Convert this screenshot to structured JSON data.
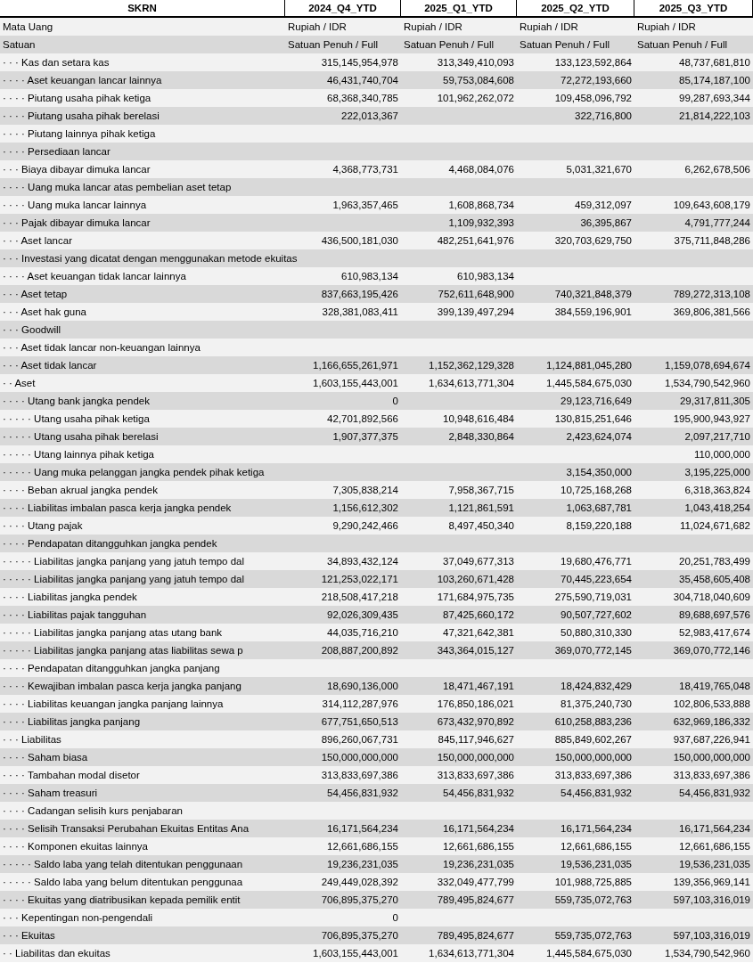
{
  "table": {
    "columns": [
      "SKRN",
      "2024_Q4_YTD",
      "2025_Q1_YTD",
      "2025_Q2_YTD",
      "2025_Q3_YTD"
    ],
    "currency_row": {
      "label": "Mata Uang",
      "column_2": "Rupiah / IDR",
      "column_3": "Rupiah / IDR",
      "column_4": "Rupiah / IDR",
      "column_5": "Rupiah / IDR"
    },
    "unit_row": {
      "label": "Satuan",
      "column_2": "Satuan Penuh / Full",
      "column_3": "Satuan Penuh / Full",
      "column_4": "Satuan Penuh / Full",
      "column_5": "Satuan Penuh / Full"
    },
    "rows": [
      {
        "label": "· · · Kas dan setara kas",
        "column_2": "315,145,954,978",
        "column_3": "313,349,410,093",
        "column_4": "133,123,592,864",
        "column_5": "48,737,681,810"
      },
      {
        "label": "· · · · Aset keuangan lancar lainnya",
        "column_2": "46,431,740,704",
        "column_3": "59,753,084,608",
        "column_4": "72,272,193,660",
        "column_5": "85,174,187,100"
      },
      {
        "label": "· · · · Piutang usaha pihak ketiga",
        "column_2": "68,368,340,785",
        "column_3": "101,962,262,072",
        "column_4": "109,458,096,792",
        "column_5": "99,287,693,344"
      },
      {
        "label": "· · · · Piutang usaha pihak berelasi",
        "column_2": "222,013,367",
        "column_4": "322,716,800",
        "column_5": "21,814,222,103"
      },
      {
        "label": "· · · · Piutang lainnya pihak ketiga"
      },
      {
        "label": "· · · · Persediaan lancar"
      },
      {
        "label": "· · · Biaya dibayar dimuka lancar",
        "column_2": "4,368,773,731",
        "column_3": "4,468,084,076",
        "column_4": "5,031,321,670",
        "column_5": "6,262,678,506"
      },
      {
        "label": "· · · · Uang muka lancar atas pembelian aset tetap"
      },
      {
        "label": "· · · · Uang muka lancar lainnya",
        "column_2": "1,963,357,465",
        "column_3": "1,608,868,734",
        "column_4": "459,312,097",
        "column_5": "109,643,608,179"
      },
      {
        "label": "· · · Pajak dibayar dimuka lancar",
        "column_3": "1,109,932,393",
        "column_4": "36,395,867",
        "column_5": "4,791,777,244"
      },
      {
        "label": "· · · Aset lancar",
        "column_2": "436,500,181,030",
        "column_3": "482,251,641,976",
        "column_4": "320,703,629,750",
        "column_5": "375,711,848,286"
      },
      {
        "label": "· · · Investasi yang dicatat dengan menggunakan metode ekuitas"
      },
      {
        "label": "· · · · Aset keuangan tidak lancar lainnya",
        "column_2": "610,983,134",
        "column_3": "610,983,134"
      },
      {
        "label": "· · · Aset tetap",
        "column_2": "837,663,195,426",
        "column_3": "752,611,648,900",
        "column_4": "740,321,848,379",
        "column_5": "789,272,313,108"
      },
      {
        "label": "· · · Aset hak guna",
        "column_2": "328,381,083,411",
        "column_3": "399,139,497,294",
        "column_4": "384,559,196,901",
        "column_5": "369,806,381,566"
      },
      {
        "label": "· · · Goodwill"
      },
      {
        "label": "· · · Aset tidak lancar non-keuangan lainnya"
      },
      {
        "label": "· · · Aset tidak lancar",
        "column_2": "1,166,655,261,971",
        "column_3": "1,152,362,129,328",
        "column_4": "1,124,881,045,280",
        "column_5": "1,159,078,694,674"
      },
      {
        "label": "· · Aset",
        "column_2": "1,603,155,443,001",
        "column_3": "1,634,613,771,304",
        "column_4": "1,445,584,675,030",
        "column_5": "1,534,790,542,960"
      },
      {
        "label": "· · · · Utang bank jangka pendek",
        "column_2": "0",
        "column_4": "29,123,716,649",
        "column_5": "29,317,811,305"
      },
      {
        "label": "· · · · · Utang usaha pihak ketiga",
        "column_2": "42,701,892,566",
        "column_3": "10,948,616,484",
        "column_4": "130,815,251,646",
        "column_5": "195,900,943,927"
      },
      {
        "label": "· · · · · Utang usaha pihak berelasi",
        "column_2": "1,907,377,375",
        "column_3": "2,848,330,864",
        "column_4": "2,423,624,074",
        "column_5": "2,097,217,710"
      },
      {
        "label": "· · · · · Utang lainnya pihak ketiga",
        "column_5": "110,000,000"
      },
      {
        "label": "· · · · · Uang muka pelanggan jangka pendek pihak ketiga",
        "column_4": "3,154,350,000",
        "column_5": "3,195,225,000"
      },
      {
        "label": "· · · · Beban akrual jangka pendek",
        "column_2": "7,305,838,214",
        "column_3": "7,958,367,715",
        "column_4": "10,725,168,268",
        "column_5": "6,318,363,824"
      },
      {
        "label": "· · · · Liabilitas imbalan pasca kerja jangka pendek",
        "column_2": "1,156,612,302",
        "column_3": "1,121,861,591",
        "column_4": "1,063,687,781",
        "column_5": "1,043,418,254"
      },
      {
        "label": "· · · · Utang pajak",
        "column_2": "9,290,242,466",
        "column_3": "8,497,450,340",
        "column_4": "8,159,220,188",
        "column_5": "11,024,671,682"
      },
      {
        "label": "· · · · Pendapatan ditangguhkan jangka pendek"
      },
      {
        "label": "· · · · · Liabilitas jangka panjang yang jatuh tempo dal",
        "column_2": "34,893,432,124",
        "column_3": "37,049,677,313",
        "column_4": "19,680,476,771",
        "column_5": "20,251,783,499"
      },
      {
        "label": "· · · · · Liabilitas jangka panjang yang jatuh tempo dal",
        "column_2": "121,253,022,171",
        "column_3": "103,260,671,428",
        "column_4": "70,445,223,654",
        "column_5": "35,458,605,408"
      },
      {
        "label": "· · · · Liabilitas jangka pendek",
        "column_2": "218,508,417,218",
        "column_3": "171,684,975,735",
        "column_4": "275,590,719,031",
        "column_5": "304,718,040,609"
      },
      {
        "label": "· · · · Liabilitas pajak tangguhan",
        "column_2": "92,026,309,435",
        "column_3": "87,425,660,172",
        "column_4": "90,507,727,602",
        "column_5": "89,688,697,576"
      },
      {
        "label": "· · · · · Liabilitas jangka panjang atas utang bank",
        "column_2": "44,035,716,210",
        "column_3": "47,321,642,381",
        "column_4": "50,880,310,330",
        "column_5": "52,983,417,674"
      },
      {
        "label": "· · · · · Liabilitas jangka panjang atas liabilitas sewa p",
        "column_2": "208,887,200,892",
        "column_3": "343,364,015,127",
        "column_4": "369,070,772,145",
        "column_5": "369,070,772,146"
      },
      {
        "label": "· · · · Pendapatan ditangguhkan jangka panjang"
      },
      {
        "label": "· · · · Kewajiban imbalan pasca kerja jangka panjang",
        "column_2": "18,690,136,000",
        "column_3": "18,471,467,191",
        "column_4": "18,424,832,429",
        "column_5": "18,419,765,048"
      },
      {
        "label": "· · · · Liabilitas keuangan jangka panjang lainnya",
        "column_2": "314,112,287,976",
        "column_3": "176,850,186,021",
        "column_4": "81,375,240,730",
        "column_5": "102,806,533,888"
      },
      {
        "label": "· · · · Liabilitas jangka panjang",
        "column_2": "677,751,650,513",
        "column_3": "673,432,970,892",
        "column_4": "610,258,883,236",
        "column_5": "632,969,186,332"
      },
      {
        "label": "· · · Liabilitas",
        "column_2": "896,260,067,731",
        "column_3": "845,117,946,627",
        "column_4": "885,849,602,267",
        "column_5": "937,687,226,941"
      },
      {
        "label": "· · · · Saham biasa",
        "column_2": "150,000,000,000",
        "column_3": "150,000,000,000",
        "column_4": "150,000,000,000",
        "column_5": "150,000,000,000"
      },
      {
        "label": "· · · · Tambahan modal disetor",
        "column_2": "313,833,697,386",
        "column_3": "313,833,697,386",
        "column_4": "313,833,697,386",
        "column_5": "313,833,697,386"
      },
      {
        "label": "· · · · Saham treasuri",
        "column_2": "54,456,831,932",
        "column_3": "54,456,831,932",
        "column_4": "54,456,831,932",
        "column_5": "54,456,831,932"
      },
      {
        "label": "· · · · Cadangan selisih kurs penjabaran"
      },
      {
        "label": "· · · · Selisih Transaksi Perubahan Ekuitas Entitas Ana",
        "column_2": "16,171,564,234",
        "column_3": "16,171,564,234",
        "column_4": "16,171,564,234",
        "column_5": "16,171,564,234"
      },
      {
        "label": "· · · · Komponen ekuitas lainnya",
        "column_2": "12,661,686,155",
        "column_3": "12,661,686,155",
        "column_4": "12,661,686,155",
        "column_5": "12,661,686,155"
      },
      {
        "label": "· · · · · Saldo laba yang telah ditentukan penggunaan",
        "column_2": "19,236,231,035",
        "column_3": "19,236,231,035",
        "column_4": "19,536,231,035",
        "column_5": "19,536,231,035"
      },
      {
        "label": "· · · · · Saldo laba yang belum ditentukan penggunaa",
        "column_2": "249,449,028,392",
        "column_3": "332,049,477,799",
        "column_4": "101,988,725,885",
        "column_5": "139,356,969,141"
      },
      {
        "label": "· · · · Ekuitas yang diatribusikan kepada pemilik entit",
        "column_2": "706,895,375,270",
        "column_3": "789,495,824,677",
        "column_4": "559,735,072,763",
        "column_5": "597,103,316,019"
      },
      {
        "label": "· · · Kepentingan non-pengendali",
        "column_2": "0"
      },
      {
        "label": "· · · Ekuitas",
        "column_2": "706,895,375,270",
        "column_3": "789,495,824,677",
        "column_4": "559,735,072,763",
        "column_5": "597,103,316,019"
      },
      {
        "label": "· · Liabilitas dan ekuitas",
        "column_2": "1,603,155,443,001",
        "column_3": "1,634,613,771,304",
        "column_4": "1,445,584,675,030",
        "column_5": "1,534,790,542,960"
      }
    ]
  }
}
